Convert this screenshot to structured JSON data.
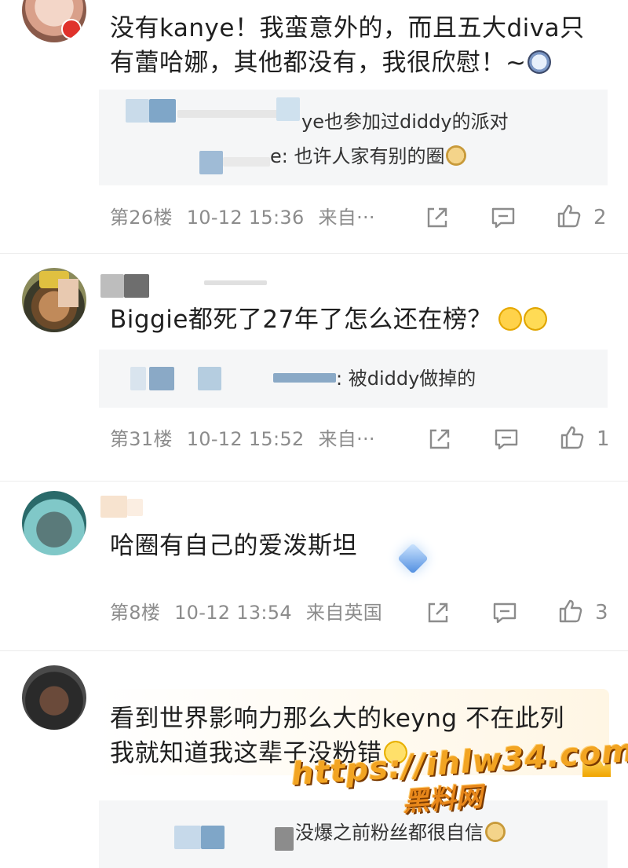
{
  "comments": [
    {
      "text": "没有kanye！我蛮意外的，而且五大diva只有蕾哈娜，其他都没有，我很欣慰！~",
      "replies": [
        {
          "text": "ye也参加过diddy的派对"
        },
        {
          "text": "e: 也许人家有别的圈"
        }
      ],
      "floor": "第26楼",
      "time": "10-12 15:36",
      "source": "来自···",
      "likes": "2"
    },
    {
      "text": "Biggie都死了27年了怎么还在榜？",
      "replies": [
        {
          "text": ": 被diddy做掉的"
        }
      ],
      "floor": "第31楼",
      "time": "10-12 15:52",
      "source": "来自···",
      "likes": "1"
    },
    {
      "text": "哈圈有自己的爱泼斯坦",
      "replies": [],
      "floor": "第8楼",
      "time": "10-12 13:54",
      "source": "来自英国",
      "likes": "3"
    },
    {
      "text_line1": "看到世界影响力那么大的keyng 不在此列",
      "text_line2": "我就知道我这辈子没粉错",
      "replies": [
        {
          "text": "没爆之前粉丝都很自信"
        }
      ]
    }
  ],
  "watermark": {
    "url": "https://ihlw34.com",
    "site": "黑料网"
  },
  "icons": {
    "share": "share-icon",
    "comment": "comment-icon",
    "like": "thumbs-up-icon"
  },
  "colors": {
    "meta_gray": "#8c8c8c",
    "reply_bg": "#f5f6f7",
    "watermark": "#f2a422"
  }
}
